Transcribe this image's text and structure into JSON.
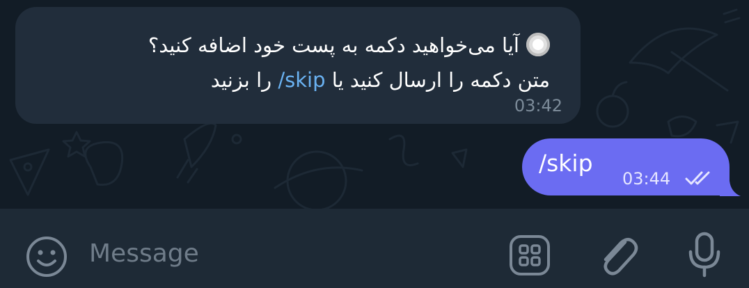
{
  "messages": [
    {
      "direction": "incoming",
      "line1": "آیا می‌خواهید دکمه به پست خود اضافه کنید؟",
      "line2_prefix": "متن دکمه را ارسال کنید یا ",
      "command": "/skip",
      "line2_suffix": " را بزنید",
      "time": "03:42"
    },
    {
      "direction": "outgoing",
      "text": "/skip",
      "time": "03:44",
      "status": "read"
    }
  ],
  "composer": {
    "placeholder": "Message"
  },
  "icons": {
    "status_radio": "radio-icon",
    "emoji": "emoji-icon",
    "commands": "commands-grid-icon",
    "attach": "paperclip-icon",
    "voice": "microphone-icon",
    "read_status": "double-check-icon"
  },
  "colors": {
    "incoming_bubble": "#212d3b",
    "outgoing_bubble": "#6b6cf2",
    "link": "#6ab2f2",
    "background": "#121c26",
    "input_bar": "#1e2a36"
  }
}
